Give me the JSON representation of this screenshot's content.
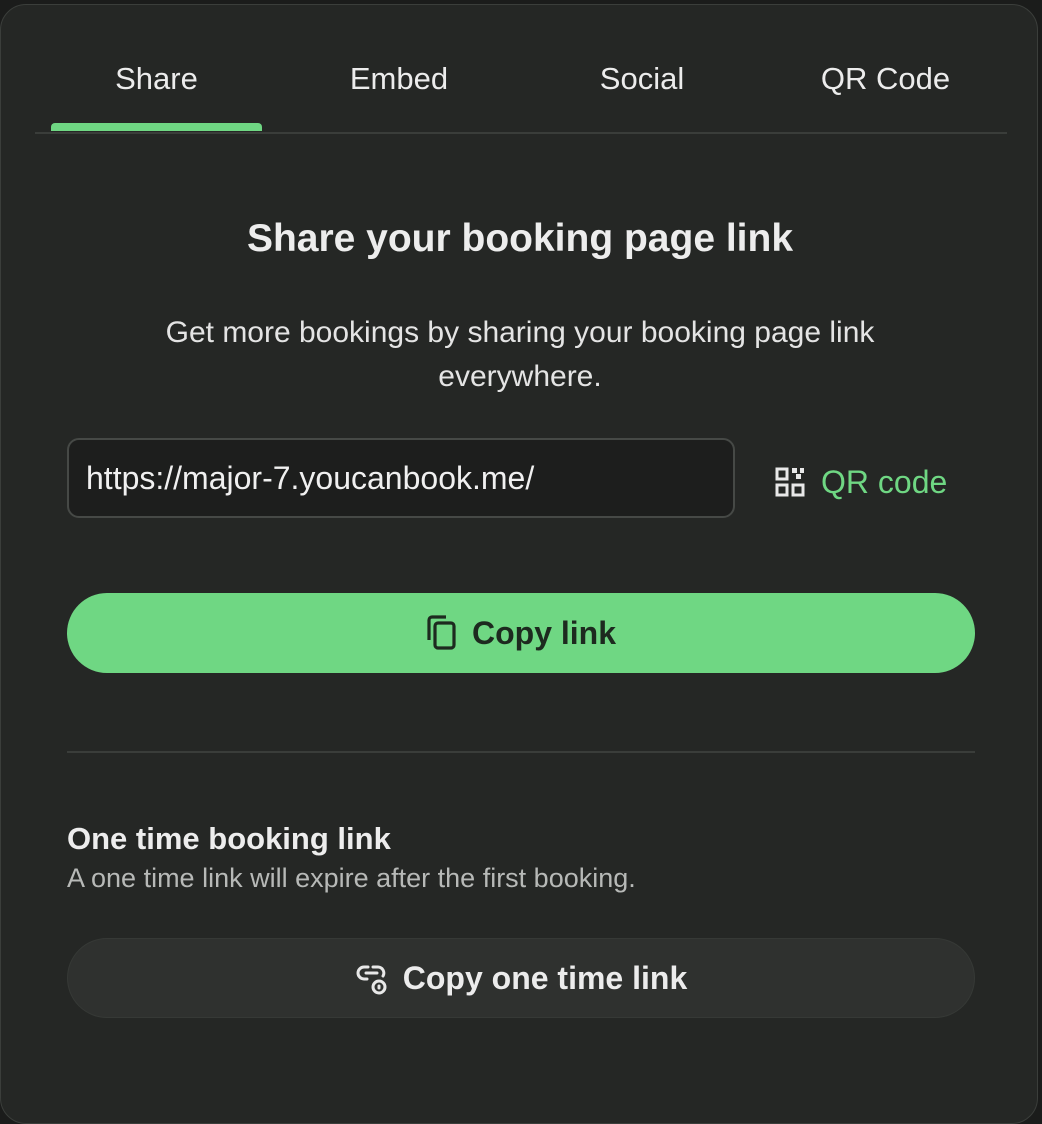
{
  "tabs": [
    {
      "label": "Share",
      "active": true
    },
    {
      "label": "Embed",
      "active": false
    },
    {
      "label": "Social",
      "active": false
    },
    {
      "label": "QR Code",
      "active": false
    }
  ],
  "main": {
    "title": "Share your booking page link",
    "subtitle": "Get more bookings by sharing your booking page link everywhere.",
    "url_value": "https://major-7.youcanbook.me/",
    "qr_link_label": "QR code",
    "copy_button_label": "Copy link"
  },
  "one_time": {
    "title": "One time booking link",
    "description": "A one time link will expire after the first booking.",
    "button_label": "Copy one time link"
  },
  "colors": {
    "accent": "#6fd783",
    "panel_background": "#252725",
    "page_background": "#1b1c1b"
  }
}
